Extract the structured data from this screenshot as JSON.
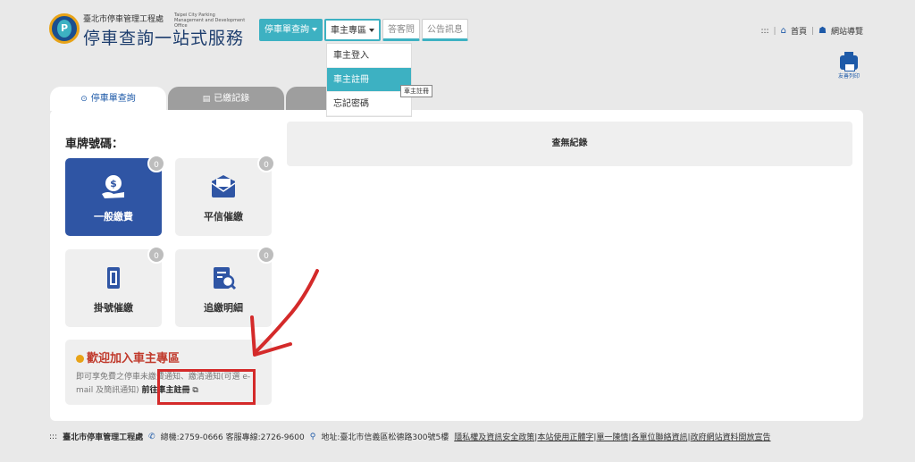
{
  "header": {
    "org_name": "臺北市停車管理工程處",
    "org_name_en": "Taipei City Parking Management and Development Office",
    "site_title": "停車查詢一站式服務",
    "logo_letter": "P"
  },
  "nav": [
    {
      "label": "停車單查詢",
      "caret": true
    },
    {
      "label": "車主專區",
      "caret": true
    },
    {
      "label": "答客問",
      "caret": false
    },
    {
      "label": "公告訊息",
      "caret": false
    }
  ],
  "dropdown": [
    "車主登入",
    "車主註冊",
    "忘記密碼"
  ],
  "tooltip": "車主註冊",
  "top_right": {
    "dots": ":::",
    "home": "首頁",
    "sitemap": "網站導覽"
  },
  "print_label": "友善列印",
  "tabs": [
    {
      "label": "停車單查詢"
    },
    {
      "label": "已繳記錄"
    },
    {
      "label": ""
    }
  ],
  "plate_label": "車牌號碼：",
  "cards": [
    {
      "label": "一般繳費",
      "count": "0"
    },
    {
      "label": "平信催繳",
      "count": "0"
    },
    {
      "label": "掛號催繳",
      "count": "0"
    },
    {
      "label": "追繳明細",
      "count": "0"
    }
  ],
  "welcome": {
    "title": "歡迎加入車主專區",
    "text": "即可享免費之停車未繳費通知、繳清通知(可選 e-mail 及簡訊通知)",
    "link": "前往車主註冊"
  },
  "no_record": "查無紀錄",
  "footer": {
    "dots": ":::",
    "org": "臺北市停車管理工程處",
    "phone": "總機:2759-0666 客服專線:2726-9600",
    "address": "地址:臺北市信義區松德路300號5樓",
    "links": [
      "隱私權及資訊安全政策",
      "本站使用正體字",
      "單一陳情",
      "各單位聯絡資訊",
      "政府網站資料開放宣告"
    ]
  },
  "colors": {
    "accent": "#3db1c2",
    "primary": "#2f55a4",
    "annotation": "#d42a2a",
    "title_text": "#c0392b"
  }
}
